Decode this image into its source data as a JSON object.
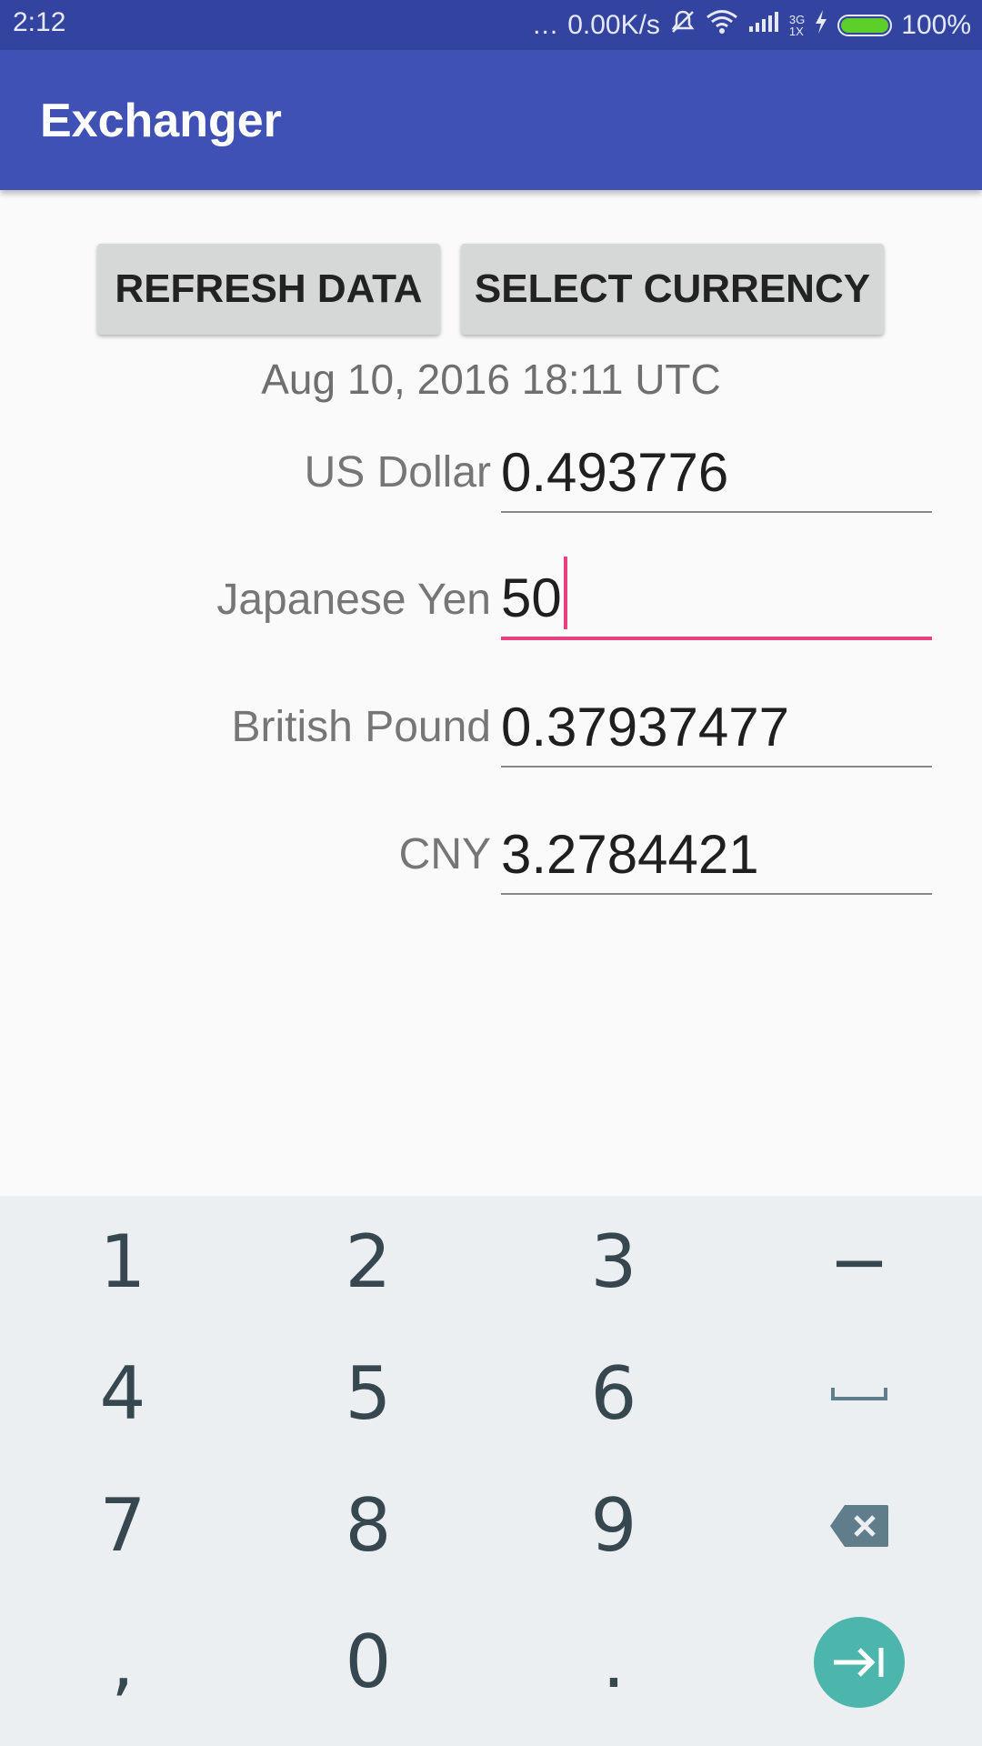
{
  "status_bar": {
    "time": "2:12",
    "dots": "...",
    "net_speed": "0.00K/s",
    "network_type_top": "3G",
    "network_type_bottom": "1X",
    "battery_percent": "100%",
    "bg_color": "#3243a0",
    "battery_color": "#5ccf2a"
  },
  "app_bar": {
    "title": "Exchanger",
    "color": "#3f51b5"
  },
  "toolbar": {
    "refresh_label": "REFRESH DATA",
    "select_currency_label": "SELECT CURRENCY"
  },
  "timestamp": "Aug 10, 2016 18:11 UTC",
  "currencies": [
    {
      "label": "US Dollar",
      "value": "0.493776",
      "focused": false
    },
    {
      "label": "Japanese Yen",
      "value": "50",
      "focused": true
    },
    {
      "label": "British Pound",
      "value": "0.37937477",
      "focused": false
    },
    {
      "label": "CNY",
      "value": "3.2784421",
      "focused": false
    }
  ],
  "accent_color": "#e94080",
  "keyboard": {
    "keys": [
      "1",
      "2",
      "3",
      "−",
      "4",
      "5",
      "6",
      "␣",
      "7",
      "8",
      "9",
      "backspace",
      ",",
      "0",
      ".",
      "next"
    ],
    "enter_color": "#4db6ac"
  }
}
